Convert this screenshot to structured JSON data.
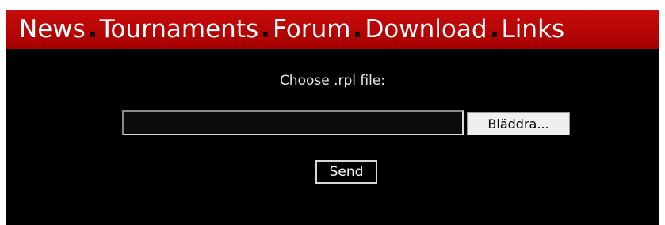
{
  "nav": {
    "items": [
      {
        "label": "News"
      },
      {
        "label": "Tournaments"
      },
      {
        "label": "Forum"
      },
      {
        "label": "Download"
      },
      {
        "label": "Links"
      }
    ]
  },
  "upload": {
    "label": "Choose .rpl file:",
    "file_value": "",
    "browse_label": "Bläddra...",
    "send_label": "Send"
  },
  "colors": {
    "nav_background": "#bb0000",
    "page_background": "#000000",
    "nav_text": "#ffffff"
  }
}
